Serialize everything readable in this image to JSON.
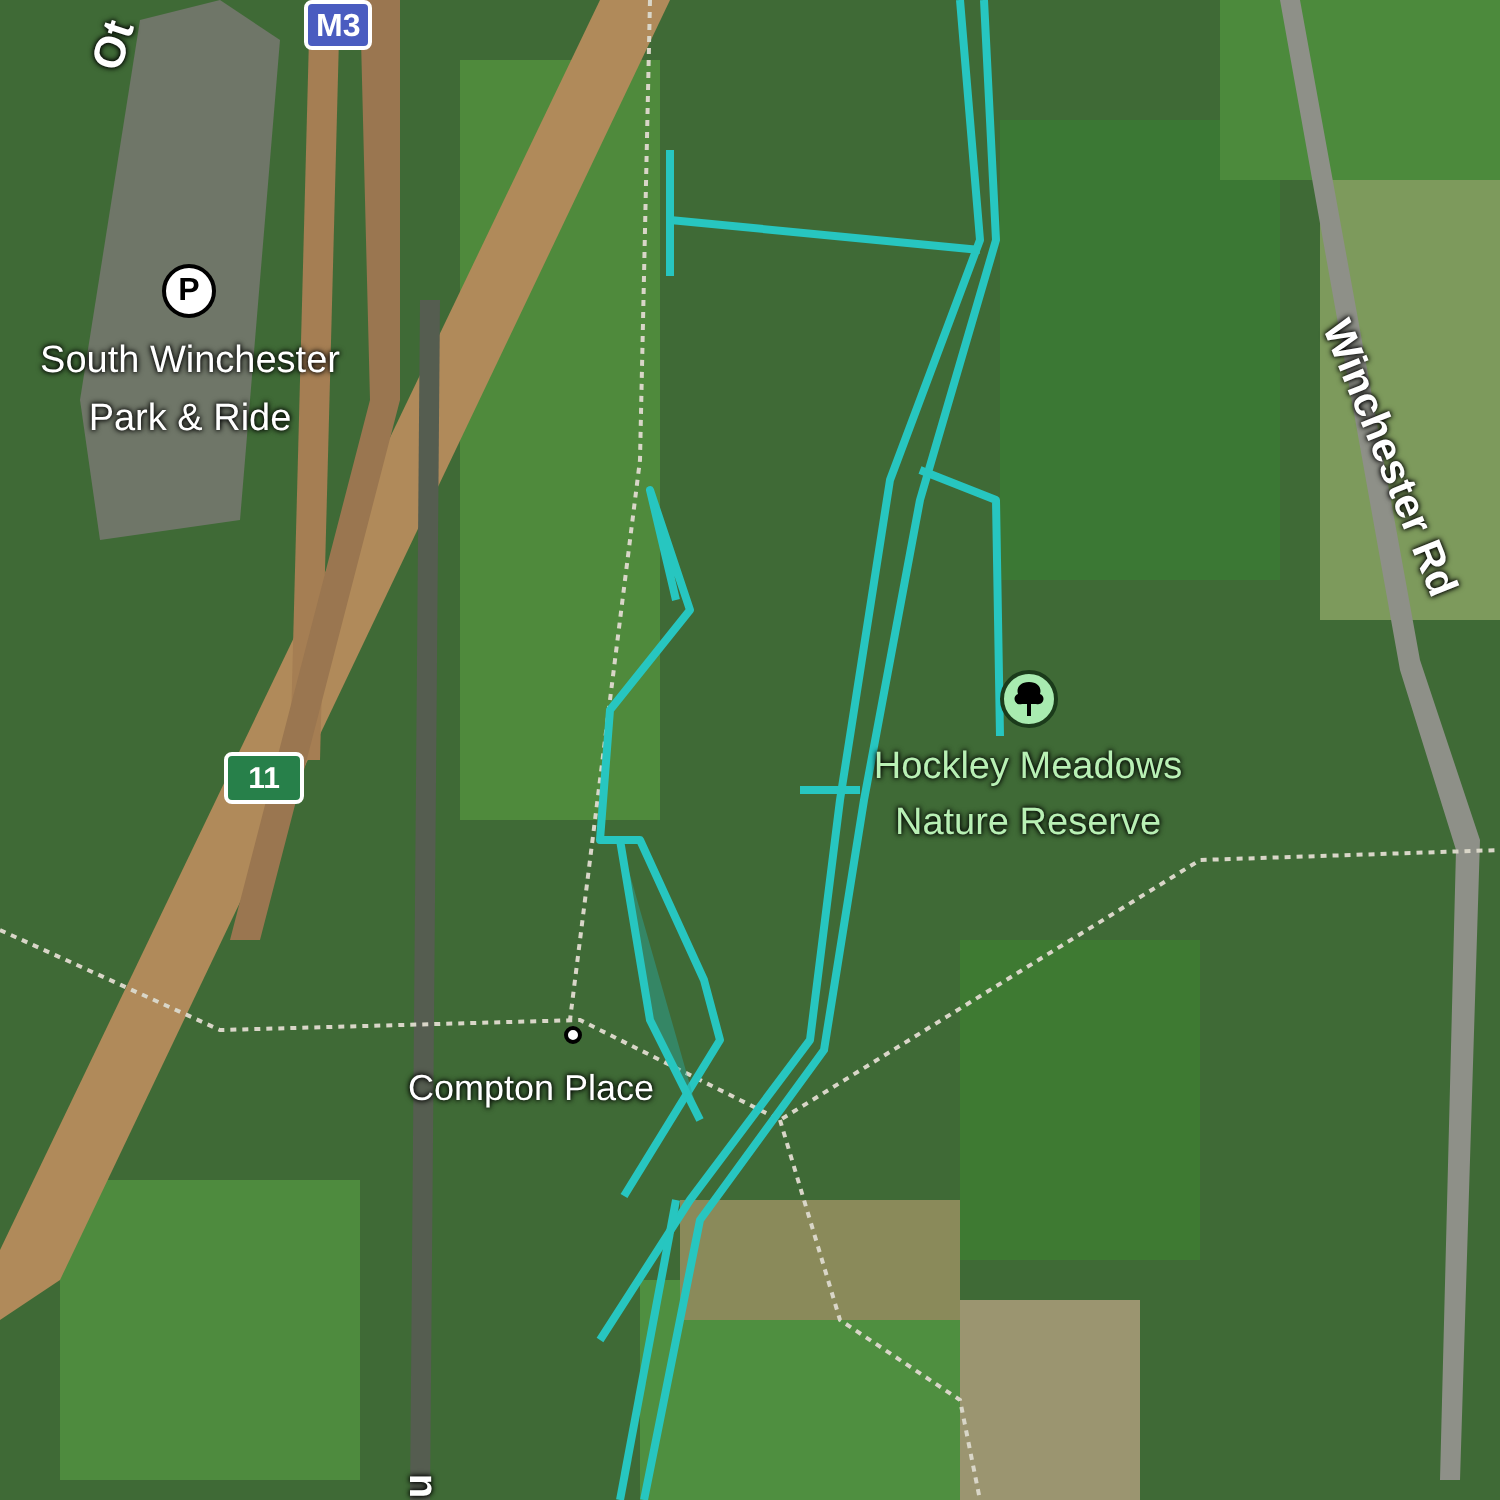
{
  "map": {
    "labels": [
      {
        "kind": "road-name",
        "text": "Ot"
      },
      {
        "kind": "motorway-shield",
        "text": "M3"
      },
      {
        "kind": "parking",
        "icon": "P",
        "text": "South Winchester Park & Ride"
      },
      {
        "kind": "junction-shield",
        "text": "11"
      },
      {
        "kind": "place",
        "text": "Compton Place"
      },
      {
        "kind": "nature",
        "text": "Hockley Meadows Nature Reserve"
      },
      {
        "kind": "road-name",
        "text": "Winchester Rd"
      },
      {
        "kind": "road-name",
        "text": "n"
      }
    ]
  }
}
